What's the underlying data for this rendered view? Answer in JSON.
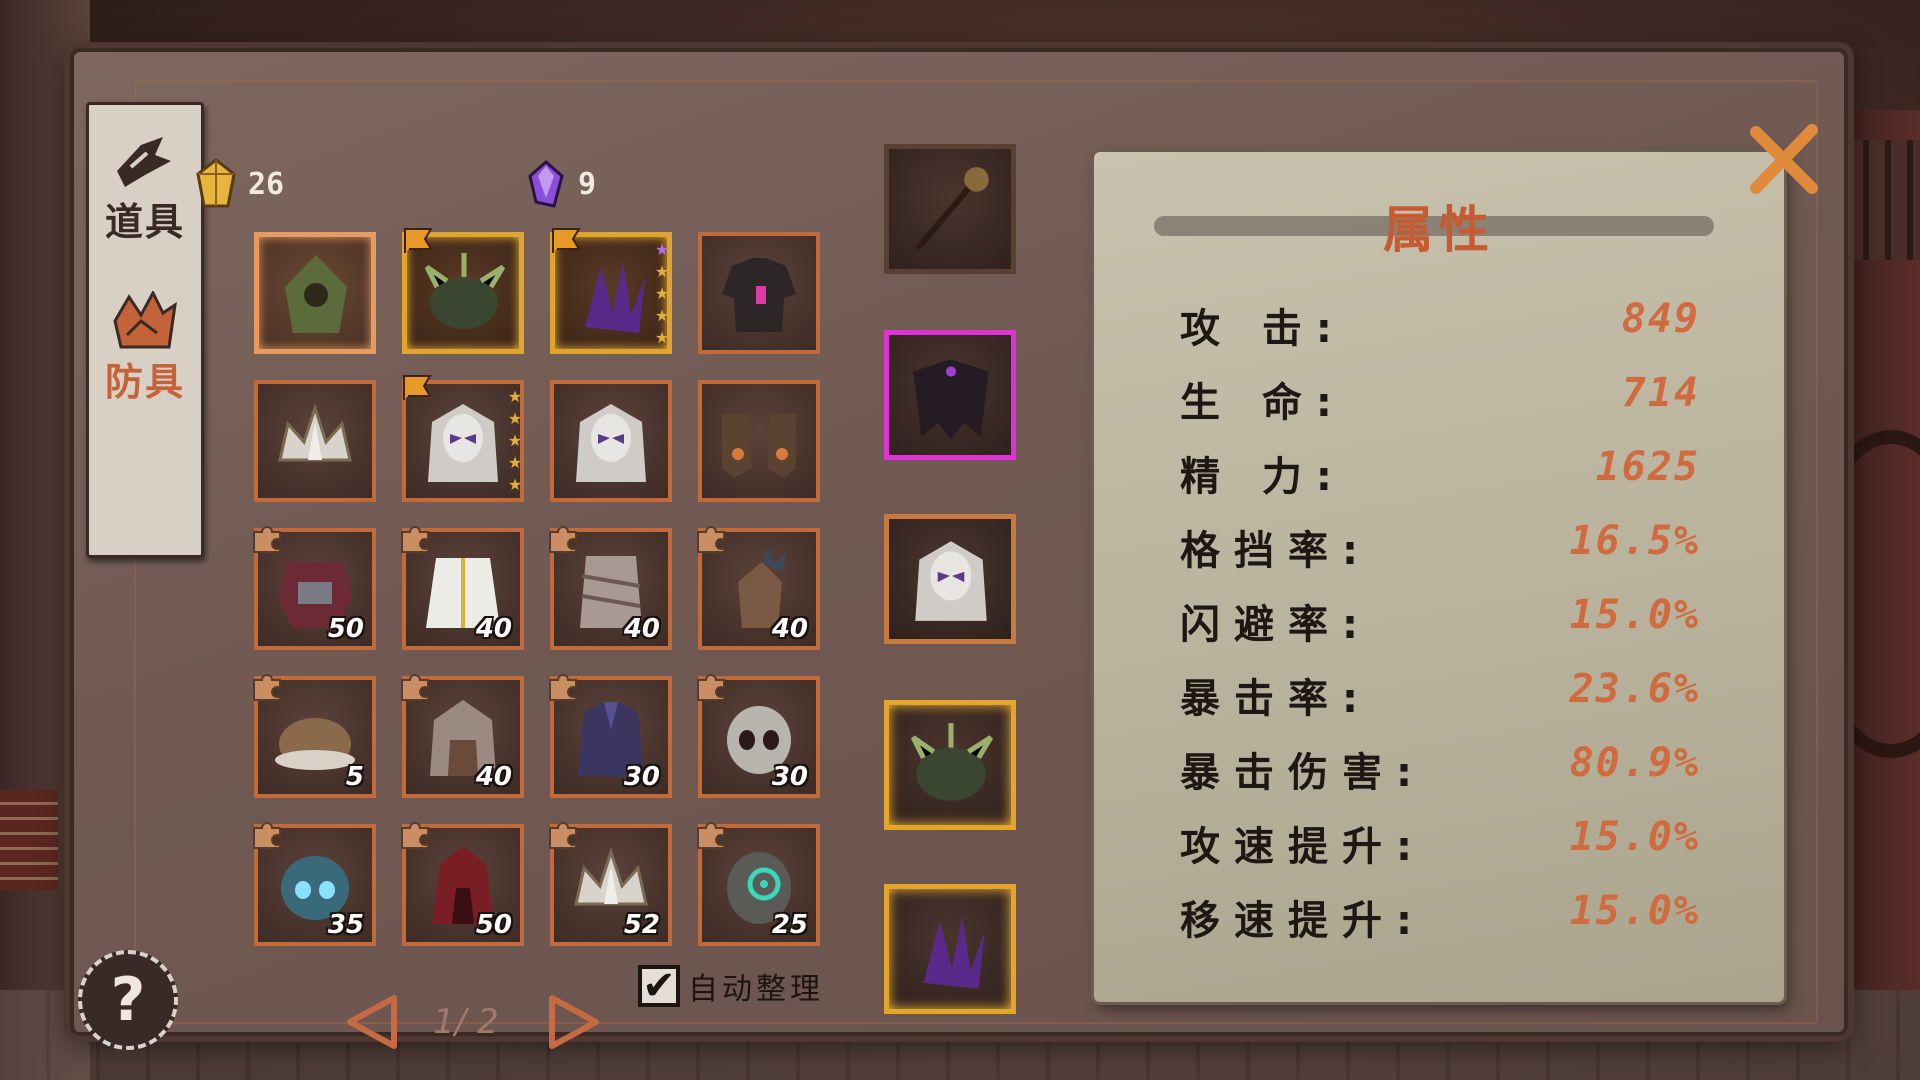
{
  "tabs": [
    {
      "label": "道具",
      "icon": "pickaxe-icon",
      "active": false
    },
    {
      "label": "防具",
      "icon": "armor-shards-icon",
      "active": true
    }
  ],
  "currency": {
    "gold_amount": "26",
    "gold_icon": "gold-crystal-icon",
    "gem_amount": "9",
    "gem_icon": "purple-gem-icon"
  },
  "inventory": {
    "items": [
      {
        "name": "goblin-hood-icon",
        "count": "",
        "frame": "selected",
        "flag": false,
        "puzzle": false,
        "stars": 0
      },
      {
        "name": "thorned-helmet-icon",
        "count": "",
        "frame": "gold",
        "flag": true,
        "puzzle": false,
        "stars": 0
      },
      {
        "name": "shadow-claw-icon",
        "count": "",
        "frame": "gold",
        "flag": true,
        "puzzle": false,
        "stars": 5
      },
      {
        "name": "dark-shirt-icon",
        "count": "",
        "frame": "normal",
        "flag": false,
        "puzzle": false,
        "stars": 0
      },
      {
        "name": "silver-crown-icon",
        "count": "",
        "frame": "normal",
        "flag": false,
        "puzzle": false,
        "stars": 0
      },
      {
        "name": "veiled-mask-icon",
        "count": "",
        "frame": "normal",
        "flag": true,
        "puzzle": false,
        "stars": 5
      },
      {
        "name": "veiled-mask-icon",
        "count": "",
        "frame": "normal",
        "flag": false,
        "puzzle": false,
        "stars": 0
      },
      {
        "name": "leather-boots-icon",
        "count": "",
        "frame": "normal",
        "flag": false,
        "puzzle": false,
        "stars": 0
      },
      {
        "name": "red-chest-armor-icon",
        "count": "50",
        "frame": "normal",
        "flag": false,
        "puzzle": true,
        "stars": 0
      },
      {
        "name": "white-robe-icon",
        "count": "40",
        "frame": "normal",
        "flag": false,
        "puzzle": true,
        "stars": 0
      },
      {
        "name": "bandage-wrap-icon",
        "count": "40",
        "frame": "normal",
        "flag": false,
        "puzzle": true,
        "stars": 0
      },
      {
        "name": "spiked-gauntlet-icon",
        "count": "40",
        "frame": "normal",
        "flag": false,
        "puzzle": true,
        "stars": 0
      },
      {
        "name": "fur-cap-icon",
        "count": "5",
        "frame": "normal",
        "flag": false,
        "puzzle": true,
        "stars": 0
      },
      {
        "name": "fur-hood-icon",
        "count": "40",
        "frame": "normal",
        "flag": false,
        "puzzle": true,
        "stars": 0
      },
      {
        "name": "purple-tunic-icon",
        "count": "30",
        "frame": "normal",
        "flag": false,
        "puzzle": true,
        "stars": 0
      },
      {
        "name": "skull-helm-icon",
        "count": "30",
        "frame": "normal",
        "flag": false,
        "puzzle": true,
        "stars": 0
      },
      {
        "name": "blue-skull-helm-icon",
        "count": "35",
        "frame": "normal",
        "flag": false,
        "puzzle": true,
        "stars": 0
      },
      {
        "name": "red-hood-icon",
        "count": "50",
        "frame": "normal",
        "flag": false,
        "puzzle": true,
        "stars": 0
      },
      {
        "name": "silver-crown-icon",
        "count": "52",
        "frame": "normal",
        "flag": false,
        "puzzle": true,
        "stars": 0
      },
      {
        "name": "stone-eye-helm-icon",
        "count": "25",
        "frame": "normal",
        "flag": false,
        "puzzle": true,
        "stars": 0
      }
    ]
  },
  "equipped": [
    {
      "name": "staff-weapon-icon",
      "frame": "plain"
    },
    {
      "name": "dark-cape-icon",
      "frame": "magenta"
    },
    {
      "name": "veiled-mask-icon",
      "frame": "orange"
    },
    {
      "name": "thorned-helmet-icon",
      "frame": "gold"
    },
    {
      "name": "shadow-claw-icon",
      "frame": "gold"
    }
  ],
  "pager": {
    "label": "1/ 2"
  },
  "auto_sort": {
    "label": "自动整理",
    "checked": true
  },
  "stats": {
    "title": "属性",
    "rows": [
      {
        "label": "攻 击:",
        "value": "849"
      },
      {
        "label": "生 命:",
        "value": "714"
      },
      {
        "label": "精 力:",
        "value": "1625"
      },
      {
        "label": "格挡率:",
        "value": "16.5%"
      },
      {
        "label": "闪避率:",
        "value": "15.0%"
      },
      {
        "label": "暴击率:",
        "value": "23.6%"
      },
      {
        "label": "暴击伤害:",
        "value": "80.9%"
      },
      {
        "label": "攻速提升:",
        "value": "15.0%"
      },
      {
        "label": "移速提升:",
        "value": "15.0%"
      }
    ]
  },
  "colors": {
    "accent_orange": "#cf6b3f",
    "gold_frame": "#e0a52f",
    "rare_magenta": "#e230d8"
  }
}
